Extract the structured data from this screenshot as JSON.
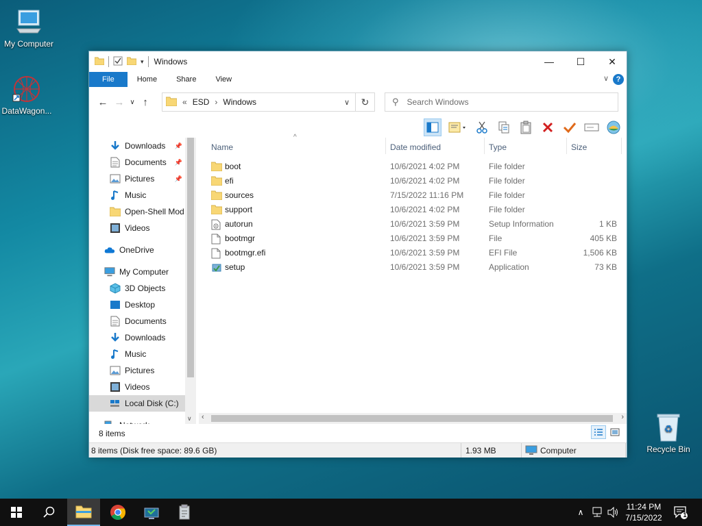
{
  "desktop": {
    "icons": [
      {
        "label": "My Computer"
      },
      {
        "label": "DataWagon..."
      },
      {
        "label": "Recycle Bin"
      }
    ]
  },
  "window": {
    "title": "Windows",
    "controls": {
      "minimize": "—",
      "maximize": "☐",
      "close": "✕"
    },
    "ribbon_tabs": [
      "File",
      "Home",
      "Share",
      "View"
    ],
    "help": "?",
    "address": {
      "overflow": "«",
      "breadcrumb": [
        "ESD",
        "Windows"
      ]
    },
    "search_placeholder": "Search Windows",
    "columns": {
      "name": "Name",
      "date": "Date modified",
      "type": "Type",
      "size": "Size"
    },
    "files": [
      {
        "name": "boot",
        "date": "10/6/2021 4:02 PM",
        "type": "File folder",
        "size": "",
        "icon": "folder-icon"
      },
      {
        "name": "efi",
        "date": "10/6/2021 4:02 PM",
        "type": "File folder",
        "size": "",
        "icon": "folder-icon"
      },
      {
        "name": "sources",
        "date": "7/15/2022 11:16 PM",
        "type": "File folder",
        "size": "",
        "icon": "folder-icon"
      },
      {
        "name": "support",
        "date": "10/6/2021 4:02 PM",
        "type": "File folder",
        "size": "",
        "icon": "folder-icon"
      },
      {
        "name": "autorun",
        "date": "10/6/2021 3:59 PM",
        "type": "Setup Information",
        "size": "1 KB",
        "icon": "setup-info-icon"
      },
      {
        "name": "bootmgr",
        "date": "10/6/2021 3:59 PM",
        "type": "File",
        "size": "405 KB",
        "icon": "file-icon"
      },
      {
        "name": "bootmgr.efi",
        "date": "10/6/2021 3:59 PM",
        "type": "EFI File",
        "size": "1,506 KB",
        "icon": "file-icon"
      },
      {
        "name": "setup",
        "date": "10/6/2021 3:59 PM",
        "type": "Application",
        "size": "73 KB",
        "icon": "application-icon"
      }
    ],
    "nav": [
      {
        "label": "Downloads",
        "icon": "download-icon",
        "pinned": true
      },
      {
        "label": "Documents",
        "icon": "document-icon",
        "pinned": true
      },
      {
        "label": "Pictures",
        "icon": "pictures-icon",
        "pinned": true
      },
      {
        "label": "Music",
        "icon": "music-icon",
        "pinned": false
      },
      {
        "label": "Open-Shell Mod",
        "icon": "folder-icon",
        "pinned": false
      },
      {
        "label": "Videos",
        "icon": "videos-icon",
        "pinned": false
      },
      {
        "label": "OneDrive",
        "icon": "cloud-icon",
        "pinned": false
      },
      {
        "label": "My Computer",
        "icon": "computer-icon",
        "pinned": false
      },
      {
        "label": "3D Objects",
        "icon": "cube-icon",
        "pinned": false
      },
      {
        "label": "Desktop",
        "icon": "desktop-icon",
        "pinned": false
      },
      {
        "label": "Documents",
        "icon": "document-icon",
        "pinned": false
      },
      {
        "label": "Downloads",
        "icon": "download-icon",
        "pinned": false
      },
      {
        "label": "Music",
        "icon": "music-icon",
        "pinned": false
      },
      {
        "label": "Pictures",
        "icon": "pictures-icon",
        "pinned": false
      },
      {
        "label": "Videos",
        "icon": "videos-icon",
        "pinned": false
      },
      {
        "label": "Local Disk (C:)",
        "icon": "drive-icon",
        "pinned": false
      },
      {
        "label": "Network",
        "icon": "network-icon",
        "pinned": false
      }
    ],
    "item_count": "8 items",
    "status": {
      "left": "8 items (Disk free space: 89.6 GB)",
      "size": "1.93 MB",
      "location": "Computer"
    }
  },
  "taskbar": {
    "time": "11:24 PM",
    "date": "7/15/2022",
    "notification_count": "1"
  },
  "colors": {
    "accent": "#1979ca",
    "folder": "#f8d775",
    "taskbar": "#101010"
  }
}
